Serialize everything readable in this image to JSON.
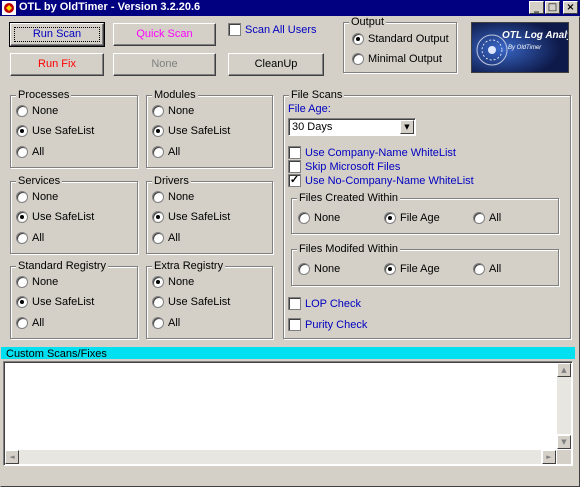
{
  "window": {
    "title": "OTL by OldTimer - Version 3.2.20.6"
  },
  "toolbar": {
    "run_scan": "Run Scan",
    "quick_scan": "Quick Scan",
    "run_fix": "Run Fix",
    "none": "None",
    "cleanup": "CleanUp",
    "scan_all_users": "Scan All Users"
  },
  "output": {
    "legend": "Output",
    "standard": "Standard Output",
    "minimal": "Minimal Output",
    "selected": "standard"
  },
  "logo": {
    "title": "OTL Log Analysis",
    "subtitle": "By OldTimer"
  },
  "groups": {
    "processes": {
      "legend": "Processes",
      "none": "None",
      "safe": "Use SafeList",
      "all": "All"
    },
    "modules": {
      "legend": "Modules",
      "none": "None",
      "safe": "Use SafeList",
      "all": "All"
    },
    "services": {
      "legend": "Services",
      "none": "None",
      "safe": "Use SafeList",
      "all": "All"
    },
    "drivers": {
      "legend": "Drivers",
      "none": "None",
      "safe": "Use SafeList",
      "all": "All"
    },
    "std_registry": {
      "legend": "Standard Registry",
      "none": "None",
      "safe": "Use SafeList",
      "all": "All"
    },
    "extra_registry": {
      "legend": "Extra Registry",
      "none": "None",
      "safe": "Use SafeList",
      "all": "All"
    }
  },
  "file_scans": {
    "legend": "File Scans",
    "file_age_label": "File Age:",
    "file_age_value": "30 Days",
    "use_company_whitelist": "Use Company-Name WhiteList",
    "skip_microsoft": "Skip Microsoft Files",
    "use_no_company_whitelist": "Use No-Company-Name WhiteList",
    "created_within": {
      "legend": "Files Created Within",
      "none": "None",
      "file_age": "File Age",
      "all": "All"
    },
    "modified_within": {
      "legend": "Files Modifed Within",
      "none": "None",
      "file_age": "File Age",
      "all": "All"
    },
    "lop_check": "LOP Check",
    "purity_check": "Purity Check"
  },
  "custom": {
    "label": "Custom Scans/Fixes",
    "text": ""
  },
  "colors": {
    "title_bar": "#000080",
    "run_scan": "#0000c0",
    "quick_scan": "#ff00ff",
    "run_fix": "#ff0000",
    "custom_bar": "#00e0f0"
  }
}
